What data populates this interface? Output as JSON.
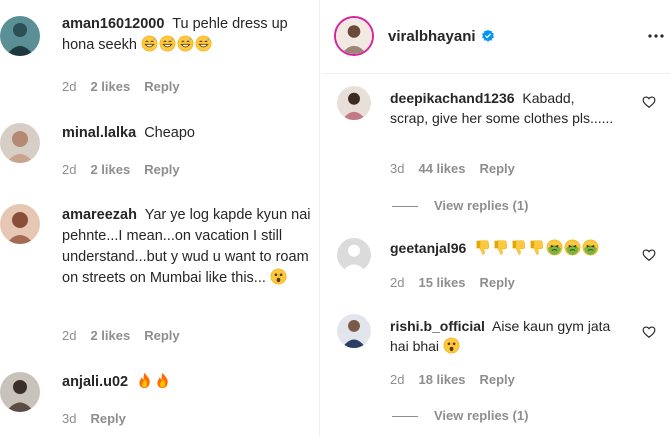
{
  "left": {
    "comments": [
      {
        "username": "aman16012000",
        "text": "Tu pehle dress up hona seekh",
        "emojis": [
          "grin-sweat",
          "grin-sweat",
          "grin-sweat",
          "grin-sweat"
        ],
        "time": "2d",
        "likes": "2 likes",
        "reply": "Reply"
      },
      {
        "username": "minal.lalka",
        "text": "Cheapo",
        "emojis": [],
        "time": "2d",
        "likes": "2 likes",
        "reply": "Reply"
      },
      {
        "username": "amareezah",
        "text": "Yar ye log kapde kyun nai pehnte...I mean...on vacation I still understand...but y wud u want to roam on streets on Mumbai like this...",
        "emojis": [
          "astonished"
        ],
        "time": "2d",
        "likes": "2 likes",
        "reply": "Reply"
      },
      {
        "username": "anjali.u02",
        "text": "",
        "emojis": [
          "fire",
          "fire"
        ],
        "time": "3d",
        "likes": "",
        "reply": "Reply"
      }
    ]
  },
  "right": {
    "header": {
      "username": "viralbhayani",
      "verified": true
    },
    "comments": [
      {
        "username": "deepikachand1236",
        "text": "Kabadd, scrap, give her some clothes pls......",
        "emojis": [],
        "time": "3d",
        "likes": "44 likes",
        "reply": "Reply",
        "view_replies": "View replies (1)"
      },
      {
        "username": "geetanjal96",
        "text": "",
        "emojis": [
          "thumbs-down",
          "thumbs-down",
          "thumbs-down",
          "thumbs-down",
          "nauseated",
          "nauseated",
          "nauseated"
        ],
        "time": "2d",
        "likes": "15 likes",
        "reply": "Reply",
        "view_replies": ""
      },
      {
        "username": "rishi.b_official",
        "text": "Aise kaun gym jata hai bhai",
        "emojis": [
          "astonished"
        ],
        "time": "2d",
        "likes": "18 likes",
        "reply": "Reply",
        "view_replies": "View replies (1)"
      }
    ]
  },
  "colors": {
    "text": "#262626",
    "meta": "#8e8e8e",
    "verified": "#0095f6",
    "emoji_yellow": "#ffc83d",
    "nausea_green": "#7cb342"
  }
}
